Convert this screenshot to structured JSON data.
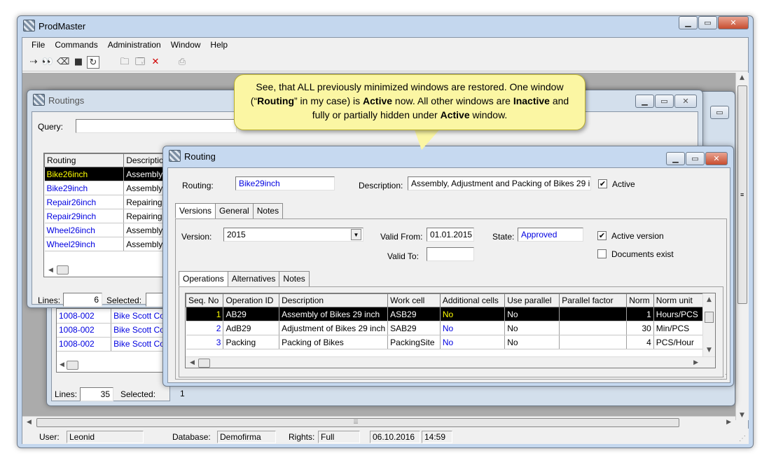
{
  "main_window": {
    "title": "ProdMaster",
    "menu": [
      "File",
      "Commands",
      "Administration",
      "Window",
      "Help"
    ],
    "status": {
      "user_label": "User:",
      "user": "Leonid",
      "db_label": "Database:",
      "db": "Demofirma",
      "rights_label": "Rights:",
      "rights": "Full",
      "date": "06.10.2016",
      "time": "14:59"
    }
  },
  "routings_window": {
    "title": "Routings",
    "query_label": "Query:",
    "query_value": "",
    "columns": [
      "Routing",
      "Description"
    ],
    "rows": [
      {
        "routing": "Bike26inch",
        "desc": "Assembly, A"
      },
      {
        "routing": "Bike29inch",
        "desc": "Assembly, A"
      },
      {
        "routing": "Repair26inch",
        "desc": "Repairing o"
      },
      {
        "routing": "Repair29inch",
        "desc": "Repairing o"
      },
      {
        "routing": "Wheel26inch",
        "desc": "Assembly a"
      },
      {
        "routing": "Wheel29inch",
        "desc": "Assembly a"
      }
    ],
    "lines_label": "Lines:",
    "lines": "6",
    "selected_label": "Selected:"
  },
  "back_window": {
    "rows": [
      {
        "id": "1008-002",
        "desc": "Bike Scott Cont"
      },
      {
        "id": "1008-002",
        "desc": "Bike Scott Cont"
      },
      {
        "id": "1008-002",
        "desc": "Bike Scott Cont"
      }
    ],
    "lines_label": "Lines:",
    "lines": "35",
    "selected_label": "Selected:",
    "selected": "1"
  },
  "routing_window": {
    "title": "Routing",
    "routing_label": "Routing:",
    "routing_value": "Bike29inch",
    "description_label": "Description:",
    "description_value": "Assembly, Adjustment and Packing of Bikes 29 i",
    "active_label": "Active",
    "tabs": [
      "Versions",
      "General",
      "Notes"
    ],
    "version_label": "Version:",
    "version_value": "2015",
    "valid_from_label": "Valid From:",
    "valid_from": "01.01.2015",
    "valid_to_label": "Valid To:",
    "valid_to": "",
    "state_label": "State:",
    "state_value": "Approved",
    "active_version_label": "Active version",
    "documents_exist_label": "Documents exist",
    "inner_tabs": [
      "Operations",
      "Alternatives",
      "Notes"
    ],
    "op_columns": [
      "Seq. No",
      "Operation ID",
      "Description",
      "Work cell",
      "Additional cells",
      "Use parallel",
      "Parallel factor",
      "Norm",
      "Norm unit"
    ],
    "ops": [
      {
        "seq": "1",
        "id": "AB29",
        "desc": "Assembly of Bikes 29 inch",
        "cell": "ASB29",
        "add": "No",
        "par": "No",
        "pf": "",
        "norm": "1",
        "unit": "Hours/PCS"
      },
      {
        "seq": "2",
        "id": "AdB29",
        "desc": "Adjustment of Bikes 29 inch",
        "cell": "SAB29",
        "add": "No",
        "par": "No",
        "pf": "",
        "norm": "30",
        "unit": "Min/PCS"
      },
      {
        "seq": "3",
        "id": "Packing",
        "desc": "Packing of Bikes",
        "cell": "PackingSite",
        "add": "No",
        "par": "No",
        "pf": "",
        "norm": "4",
        "unit": "PCS/Hour"
      }
    ]
  },
  "callout": {
    "p1": "See, that ALL previously minimized windows are restored. One window (“",
    "b1": "Routing",
    "p2": "” in my case) is ",
    "b2": "Active",
    "p3": " now.  All other windows are ",
    "b3": "Inactive",
    "p4": " and fully or partially hidden under ",
    "b4": "Active",
    "p5": " window."
  },
  "colors": {
    "accent_link": "#0000e0",
    "selection": "#000000",
    "callout_bg": "#fbf6a3"
  }
}
